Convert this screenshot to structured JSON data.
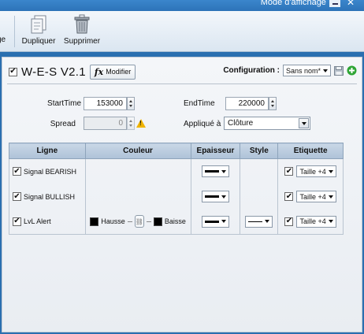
{
  "window": {
    "mode_label": "Mode d'affichage"
  },
  "toolbar": {
    "partial_label": "ge",
    "duplicate_label": "Dupliquer",
    "delete_label": "Supprimer"
  },
  "indicator": {
    "enabled": true,
    "title": "W-E-S V2.1",
    "modify_label": "Modifier",
    "modify_icon": "fx"
  },
  "configuration": {
    "label": "Configuration :",
    "value": "Sans nom*"
  },
  "params": {
    "start_time_label": "StartTime",
    "start_time_value": "153000",
    "end_time_label": "EndTime",
    "end_time_value": "220000",
    "spread_label": "Spread",
    "spread_value": "0",
    "applied_label": "Appliqué à",
    "applied_value": "Clôture",
    "warning_glyph": "!"
  },
  "table": {
    "headers": [
      "Ligne",
      "Couleur",
      "Epaisseur",
      "Style",
      "Etiquette"
    ],
    "rows": [
      {
        "checked": true,
        "name": "Signal BEARISH",
        "label": "Taille +4"
      },
      {
        "checked": true,
        "name": "Signal BULLISH",
        "label": "Taille +4"
      },
      {
        "checked": true,
        "name": "LvL Alert",
        "up_label": "Hausse",
        "down_label": "Baisse",
        "label": "Taille +4"
      }
    ]
  },
  "colors": {
    "accent_blue": "#2a6fb0",
    "add_green": "#2fa535",
    "warning": "#f0b400"
  }
}
